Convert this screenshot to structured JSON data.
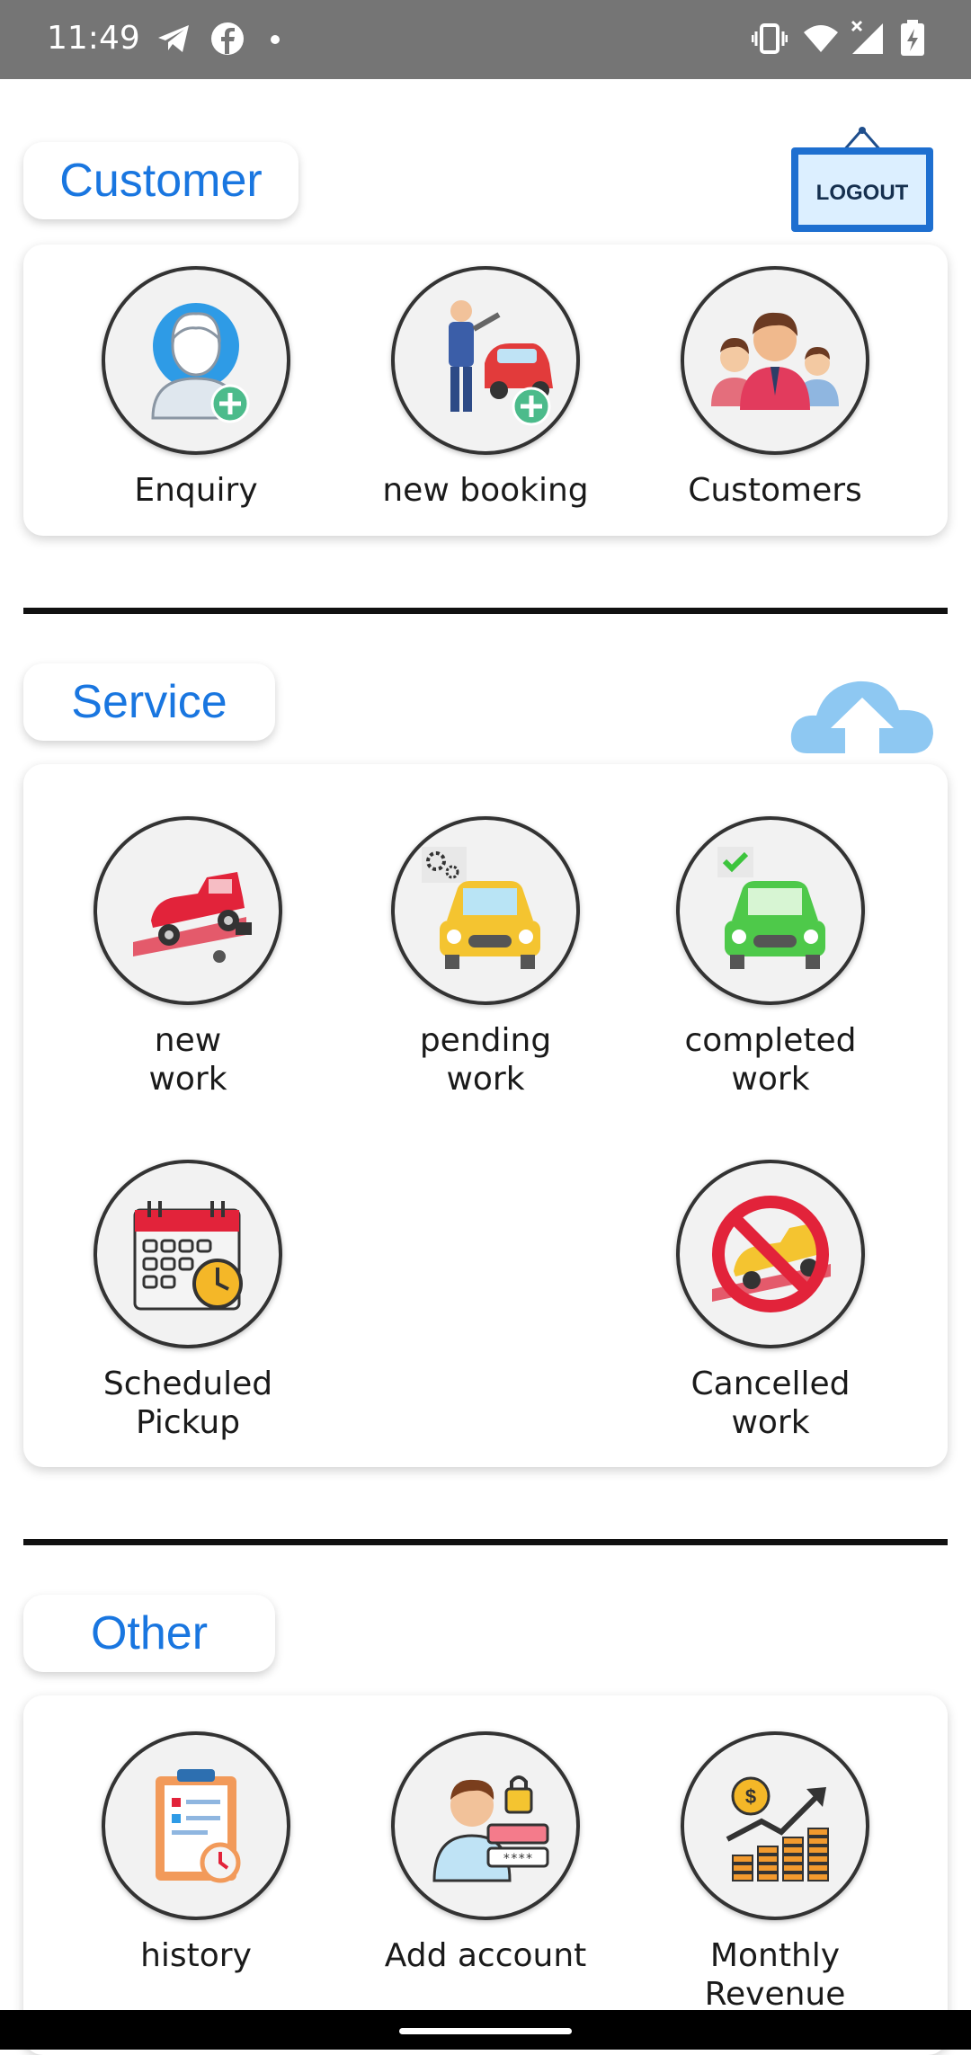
{
  "status_bar": {
    "time": "11:49",
    "left_icons": [
      "telegram-icon",
      "facebook-icon",
      "dot-icon"
    ],
    "right_icons": [
      "vibrate-icon",
      "wifi-icon",
      "signal-icon",
      "battery-icon"
    ]
  },
  "sections": {
    "customer": {
      "label": "Customer",
      "items": [
        {
          "label": "Enquiry",
          "icon": "enquiry-person-add-icon"
        },
        {
          "label": "new booking",
          "icon": "mechanic-car-add-icon"
        },
        {
          "label": "Customers",
          "icon": "customers-group-icon"
        }
      ]
    },
    "service": {
      "label": "Service",
      "items": [
        {
          "label": "new\nwork",
          "icon": "tow-truck-icon"
        },
        {
          "label": "pending\nwork",
          "icon": "pending-car-gears-icon"
        },
        {
          "label": "completed\nwork",
          "icon": "completed-car-check-icon"
        },
        {
          "label": "Scheduled\nPickup",
          "icon": "calendar-clock-icon"
        },
        {
          "label": "Cancelled\nwork",
          "icon": "cancelled-car-icon"
        }
      ]
    },
    "other": {
      "label": "Other",
      "items": [
        {
          "label": "history",
          "icon": "history-clipboard-icon"
        },
        {
          "label": "Add account",
          "icon": "add-account-lock-icon"
        },
        {
          "label": "Monthly\nRevenue",
          "icon": "revenue-chart-icon"
        }
      ]
    }
  },
  "logout": {
    "label": "LOGOUT",
    "icon": "logout-sign-icon"
  },
  "upload": {
    "icon": "cloud-upload-icon"
  },
  "colors": {
    "accent": "#1976e0",
    "status_bar": "#757575",
    "divider": "#111111"
  }
}
